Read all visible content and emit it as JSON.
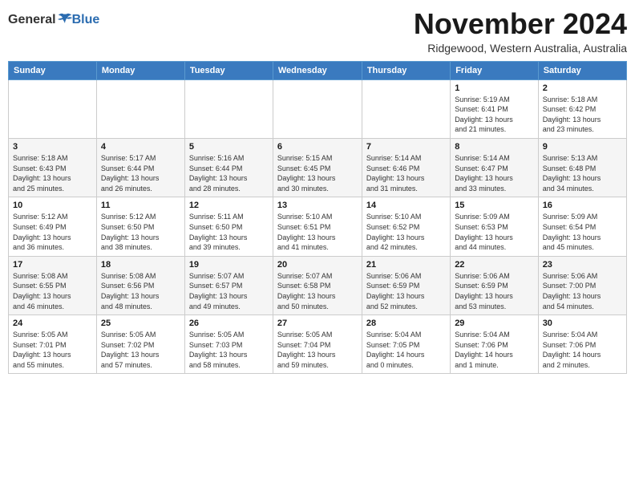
{
  "header": {
    "logo_general": "General",
    "logo_blue": "Blue",
    "month_title": "November 2024",
    "location": "Ridgewood, Western Australia, Australia"
  },
  "calendar": {
    "days_of_week": [
      "Sunday",
      "Monday",
      "Tuesday",
      "Wednesday",
      "Thursday",
      "Friday",
      "Saturday"
    ],
    "weeks": [
      [
        {
          "day": "",
          "info": ""
        },
        {
          "day": "",
          "info": ""
        },
        {
          "day": "",
          "info": ""
        },
        {
          "day": "",
          "info": ""
        },
        {
          "day": "",
          "info": ""
        },
        {
          "day": "1",
          "info": "Sunrise: 5:19 AM\nSunset: 6:41 PM\nDaylight: 13 hours\nand 21 minutes."
        },
        {
          "day": "2",
          "info": "Sunrise: 5:18 AM\nSunset: 6:42 PM\nDaylight: 13 hours\nand 23 minutes."
        }
      ],
      [
        {
          "day": "3",
          "info": "Sunrise: 5:18 AM\nSunset: 6:43 PM\nDaylight: 13 hours\nand 25 minutes."
        },
        {
          "day": "4",
          "info": "Sunrise: 5:17 AM\nSunset: 6:44 PM\nDaylight: 13 hours\nand 26 minutes."
        },
        {
          "day": "5",
          "info": "Sunrise: 5:16 AM\nSunset: 6:44 PM\nDaylight: 13 hours\nand 28 minutes."
        },
        {
          "day": "6",
          "info": "Sunrise: 5:15 AM\nSunset: 6:45 PM\nDaylight: 13 hours\nand 30 minutes."
        },
        {
          "day": "7",
          "info": "Sunrise: 5:14 AM\nSunset: 6:46 PM\nDaylight: 13 hours\nand 31 minutes."
        },
        {
          "day": "8",
          "info": "Sunrise: 5:14 AM\nSunset: 6:47 PM\nDaylight: 13 hours\nand 33 minutes."
        },
        {
          "day": "9",
          "info": "Sunrise: 5:13 AM\nSunset: 6:48 PM\nDaylight: 13 hours\nand 34 minutes."
        }
      ],
      [
        {
          "day": "10",
          "info": "Sunrise: 5:12 AM\nSunset: 6:49 PM\nDaylight: 13 hours\nand 36 minutes."
        },
        {
          "day": "11",
          "info": "Sunrise: 5:12 AM\nSunset: 6:50 PM\nDaylight: 13 hours\nand 38 minutes."
        },
        {
          "day": "12",
          "info": "Sunrise: 5:11 AM\nSunset: 6:50 PM\nDaylight: 13 hours\nand 39 minutes."
        },
        {
          "day": "13",
          "info": "Sunrise: 5:10 AM\nSunset: 6:51 PM\nDaylight: 13 hours\nand 41 minutes."
        },
        {
          "day": "14",
          "info": "Sunrise: 5:10 AM\nSunset: 6:52 PM\nDaylight: 13 hours\nand 42 minutes."
        },
        {
          "day": "15",
          "info": "Sunrise: 5:09 AM\nSunset: 6:53 PM\nDaylight: 13 hours\nand 44 minutes."
        },
        {
          "day": "16",
          "info": "Sunrise: 5:09 AM\nSunset: 6:54 PM\nDaylight: 13 hours\nand 45 minutes."
        }
      ],
      [
        {
          "day": "17",
          "info": "Sunrise: 5:08 AM\nSunset: 6:55 PM\nDaylight: 13 hours\nand 46 minutes."
        },
        {
          "day": "18",
          "info": "Sunrise: 5:08 AM\nSunset: 6:56 PM\nDaylight: 13 hours\nand 48 minutes."
        },
        {
          "day": "19",
          "info": "Sunrise: 5:07 AM\nSunset: 6:57 PM\nDaylight: 13 hours\nand 49 minutes."
        },
        {
          "day": "20",
          "info": "Sunrise: 5:07 AM\nSunset: 6:58 PM\nDaylight: 13 hours\nand 50 minutes."
        },
        {
          "day": "21",
          "info": "Sunrise: 5:06 AM\nSunset: 6:59 PM\nDaylight: 13 hours\nand 52 minutes."
        },
        {
          "day": "22",
          "info": "Sunrise: 5:06 AM\nSunset: 6:59 PM\nDaylight: 13 hours\nand 53 minutes."
        },
        {
          "day": "23",
          "info": "Sunrise: 5:06 AM\nSunset: 7:00 PM\nDaylight: 13 hours\nand 54 minutes."
        }
      ],
      [
        {
          "day": "24",
          "info": "Sunrise: 5:05 AM\nSunset: 7:01 PM\nDaylight: 13 hours\nand 55 minutes."
        },
        {
          "day": "25",
          "info": "Sunrise: 5:05 AM\nSunset: 7:02 PM\nDaylight: 13 hours\nand 57 minutes."
        },
        {
          "day": "26",
          "info": "Sunrise: 5:05 AM\nSunset: 7:03 PM\nDaylight: 13 hours\nand 58 minutes."
        },
        {
          "day": "27",
          "info": "Sunrise: 5:05 AM\nSunset: 7:04 PM\nDaylight: 13 hours\nand 59 minutes."
        },
        {
          "day": "28",
          "info": "Sunrise: 5:04 AM\nSunset: 7:05 PM\nDaylight: 14 hours\nand 0 minutes."
        },
        {
          "day": "29",
          "info": "Sunrise: 5:04 AM\nSunset: 7:06 PM\nDaylight: 14 hours\nand 1 minute."
        },
        {
          "day": "30",
          "info": "Sunrise: 5:04 AM\nSunset: 7:06 PM\nDaylight: 14 hours\nand 2 minutes."
        }
      ]
    ]
  }
}
